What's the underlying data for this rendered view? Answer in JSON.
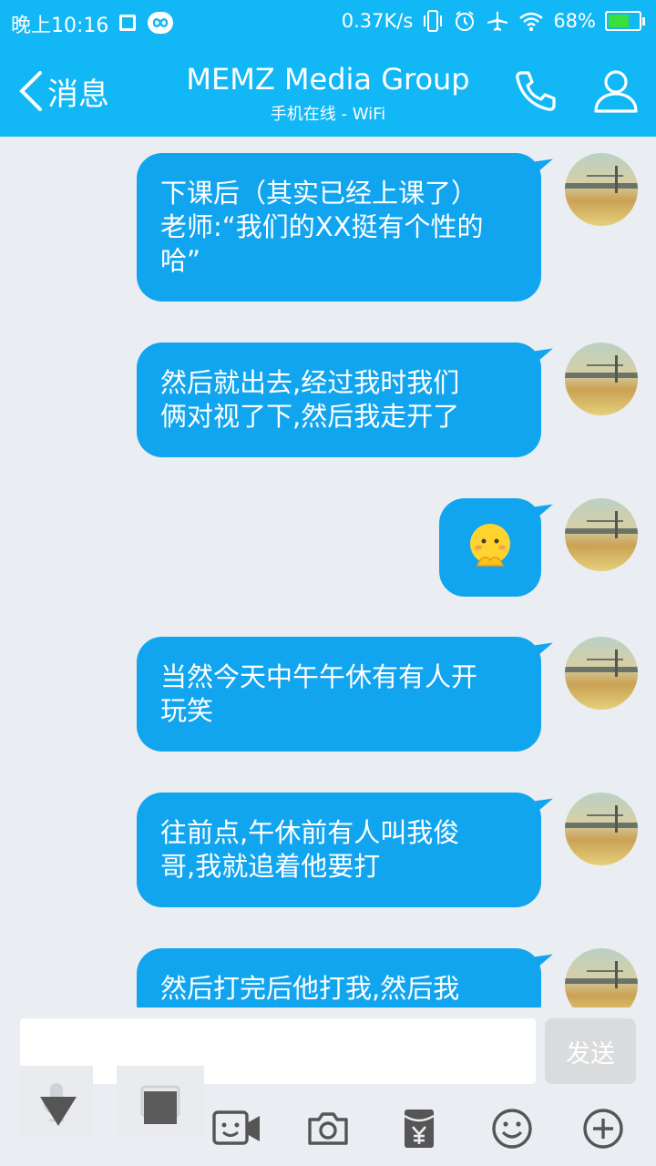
{
  "status_bar": {
    "time": "晚上10:16",
    "net_speed": "0.37K/s",
    "battery_pct": "68%",
    "battery_level": 0.68,
    "icons": [
      "notification-square-icon",
      "loop-icon",
      "vibrate-icon",
      "alarm-icon",
      "airplane-mode-icon",
      "wifi-icon",
      "battery-charging-icon"
    ]
  },
  "header": {
    "back_label": "消息",
    "title": "MEMZ Media Group",
    "subtitle": "手机在线 - WiFi",
    "icons": [
      "back-chevron-icon",
      "phone-icon",
      "person-icon"
    ]
  },
  "messages": [
    {
      "type": "text",
      "lines": [
        "下课后（其实已经上课了）",
        "老师:“我们的XX挺有个性的",
        "哈”"
      ]
    },
    {
      "type": "text",
      "lines": [
        "然后就出去,经过我时我们",
        "俩对视了下,然后我走开了"
      ]
    },
    {
      "type": "emoji",
      "emoji": "shy-face-emoji"
    },
    {
      "type": "text",
      "lines": [
        "当然今天中午午休有有人开",
        "玩笑"
      ]
    },
    {
      "type": "text",
      "lines": [
        "往前点,午休前有人叫我俊",
        "哥,我就追着他要打"
      ]
    },
    {
      "type": "text",
      "lines": [
        "然后打完后他打我,然后我"
      ]
    }
  ],
  "input": {
    "value": "",
    "send_label": "发送"
  },
  "toolbar": [
    "mic-icon",
    "image-icon",
    "video-call-icon",
    "camera-icon",
    "red-packet-icon",
    "emoji-icon",
    "plus-icon"
  ],
  "colors": {
    "brand": "#12b7f5",
    "bubble": "#12a5ef",
    "background": "#eaedf1",
    "send_disabled": "#d9dbdd"
  }
}
